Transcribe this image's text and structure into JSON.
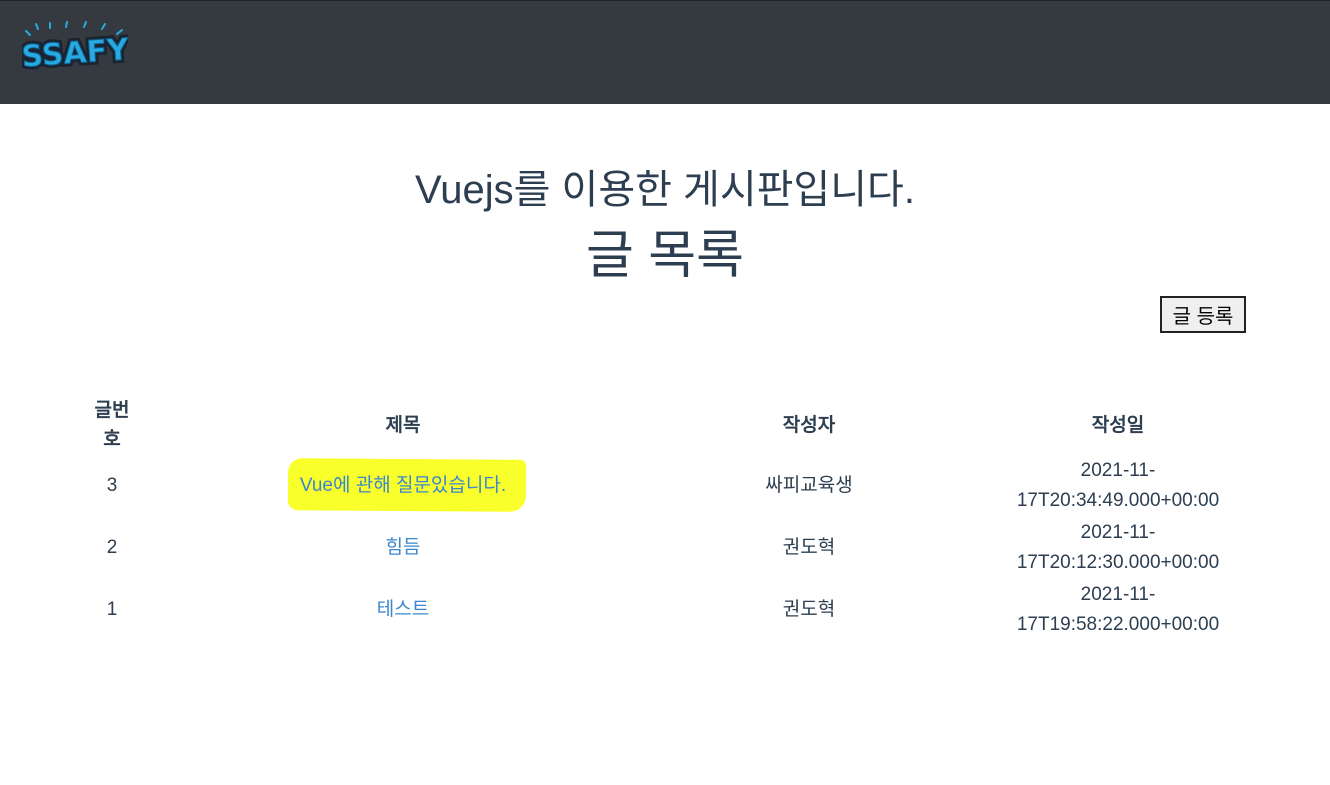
{
  "header": {
    "logo_text": "SSAFY"
  },
  "page": {
    "heading": "Vuejs를 이용한 게시판입니다.",
    "subheading": "글 목록",
    "register_button": "글 등록"
  },
  "table": {
    "headers": {
      "no": "글번호",
      "title": "제목",
      "writer": "작성자",
      "date": "작성일"
    },
    "rows": [
      {
        "no": "3",
        "title": "Vue에 관해 질문있습니다.",
        "writer": "싸피교육생",
        "date": "2021-11-17T20:34:49.000+00:00",
        "highlighted": true
      },
      {
        "no": "2",
        "title": "힘듬",
        "writer": "권도혁",
        "date": "2021-11-17T20:12:30.000+00:00"
      },
      {
        "no": "1",
        "title": "테스트",
        "writer": "권도혁",
        "date": "2021-11-17T19:58:22.000+00:00"
      }
    ]
  },
  "colors": {
    "navbar": "#343a40",
    "text": "#2c3e50",
    "link": "#3a87cf",
    "highlight": "#f8ff2a",
    "logo": "#29a9e1"
  }
}
